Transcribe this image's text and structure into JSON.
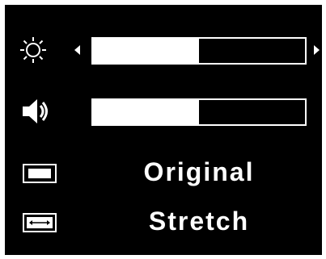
{
  "osd": {
    "rows": [
      {
        "id": "brightness",
        "icon": "brightness-icon",
        "level": 0.5,
        "has_arrows": true
      },
      {
        "id": "volume",
        "icon": "speaker-icon",
        "level": 0.5,
        "has_arrows": false
      },
      {
        "id": "display-mode",
        "icon": "original-aspect-icon",
        "label": "Original"
      },
      {
        "id": "scaling-mode",
        "icon": "stretch-aspect-icon",
        "label": "Stretch"
      }
    ]
  },
  "colors": {
    "background": "#000000",
    "foreground": "#ffffff"
  }
}
